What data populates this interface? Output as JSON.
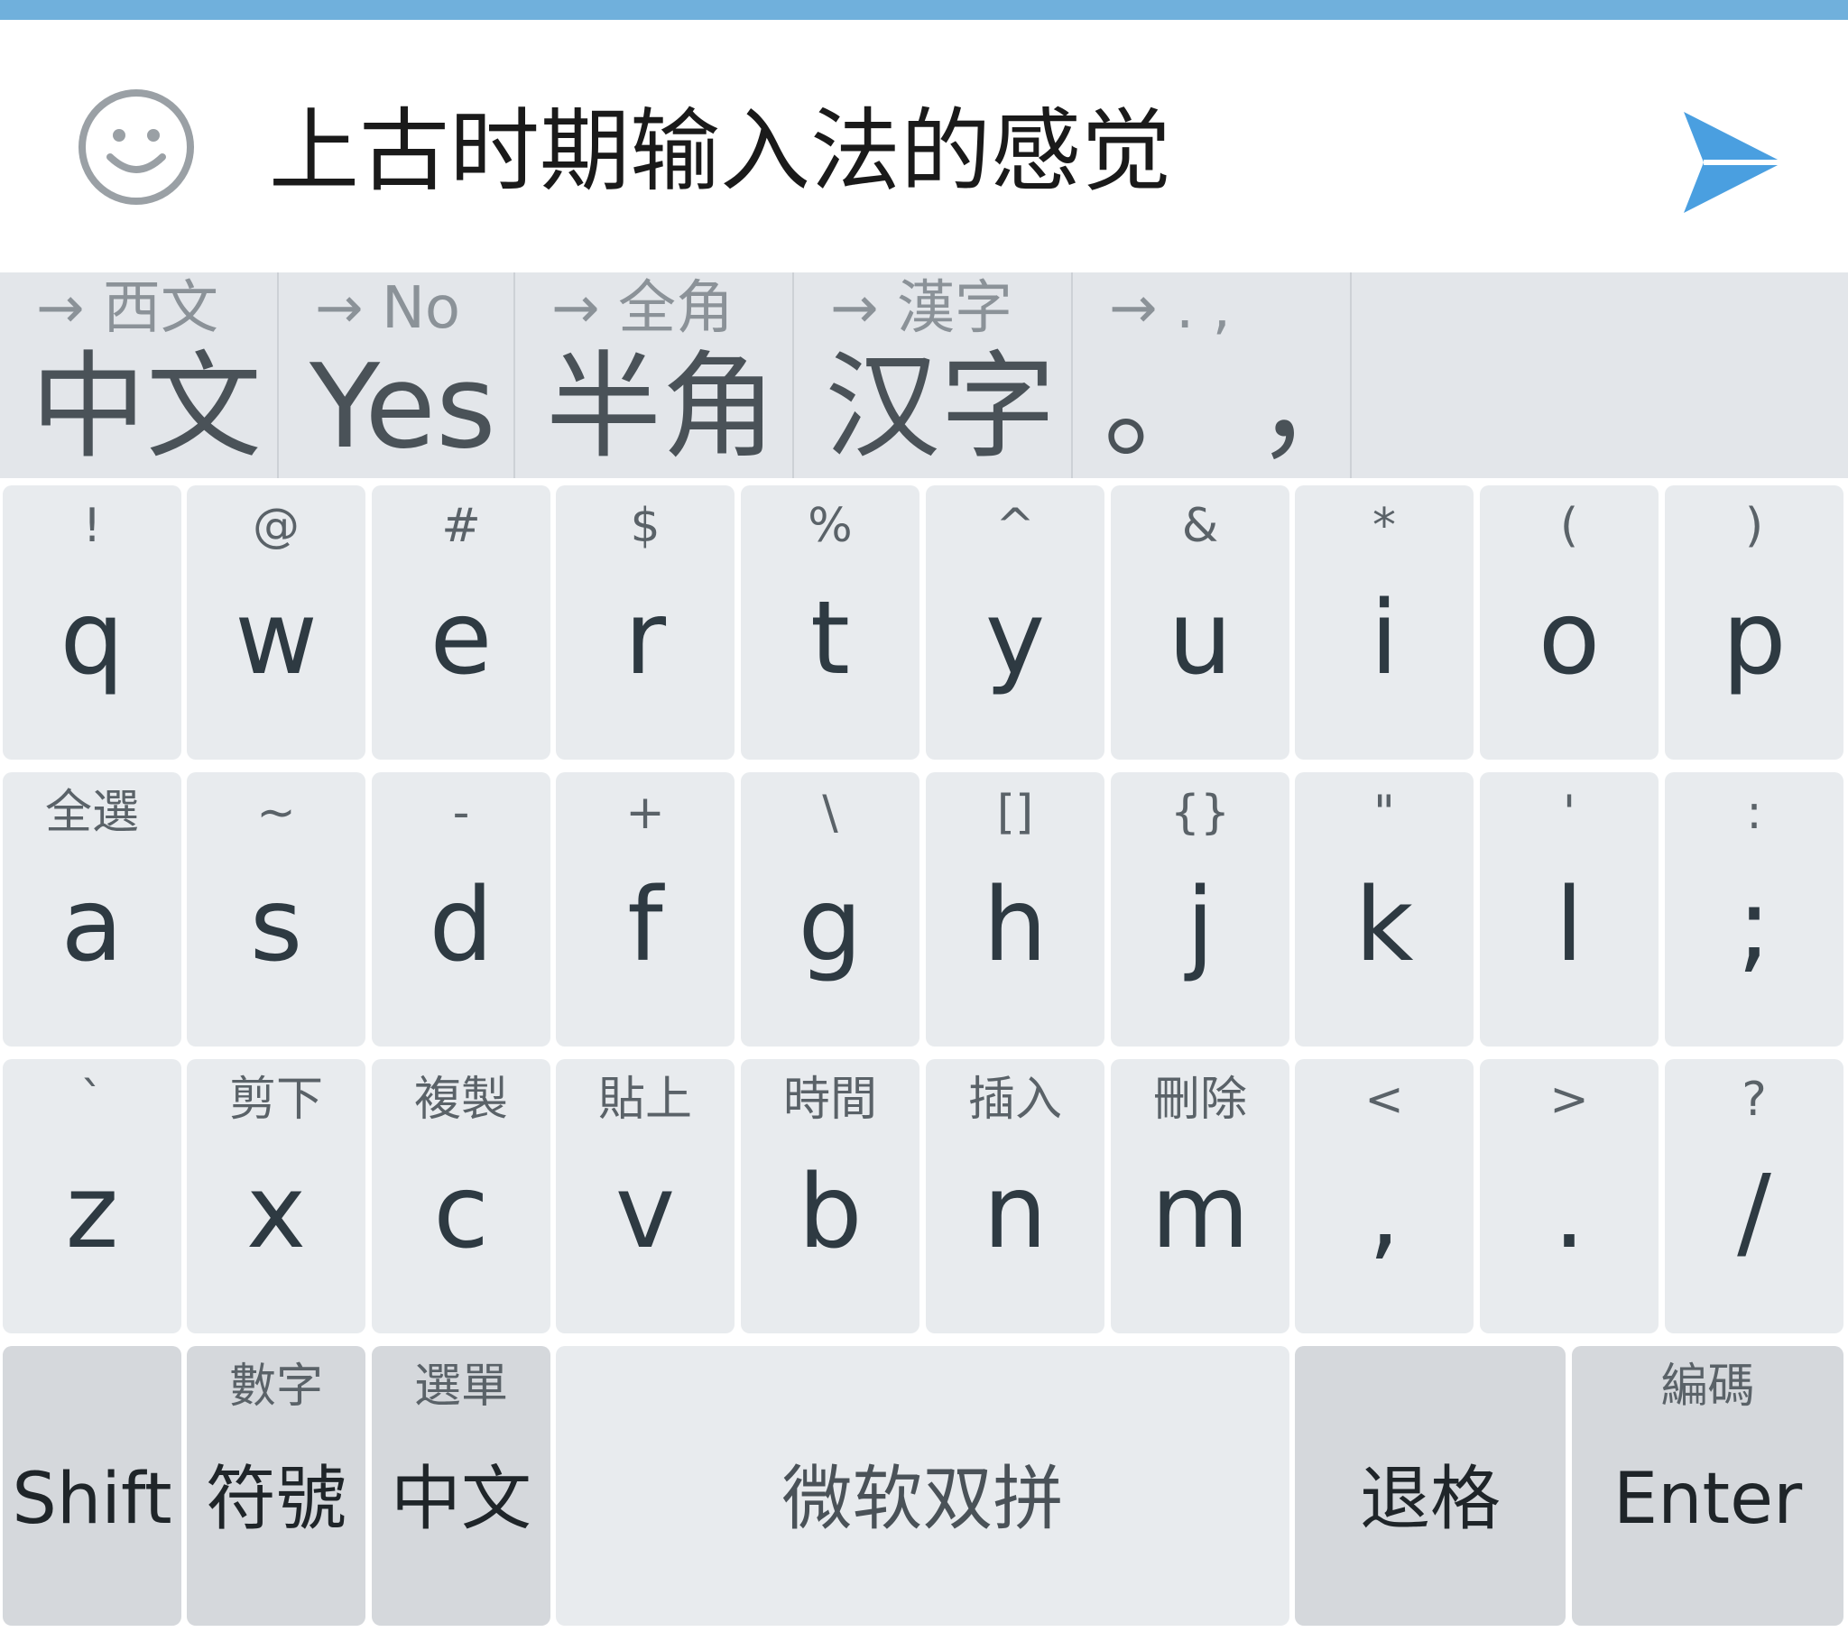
{
  "composer": {
    "message": "上古时期输入法的感觉",
    "emoji_icon": "smiley-face-icon",
    "send_icon": "send-arrow-icon",
    "accent_color": "#4a9fe0"
  },
  "mode_toggles": [
    {
      "hint": "→ 西文",
      "label": "中文"
    },
    {
      "hint": "→ No",
      "label": "Yes"
    },
    {
      "hint": "→ 全角",
      "label": "半角"
    },
    {
      "hint": "→ 漢字",
      "label": "汉字"
    },
    {
      "hint": "→ .  ,",
      "label": "。 ，"
    }
  ],
  "keyboard": {
    "row1": [
      {
        "alt": "!",
        "key": "q"
      },
      {
        "alt": "@",
        "key": "w"
      },
      {
        "alt": "#",
        "key": "e"
      },
      {
        "alt": "$",
        "key": "r"
      },
      {
        "alt": "%",
        "key": "t"
      },
      {
        "alt": "^",
        "key": "y"
      },
      {
        "alt": "&",
        "key": "u"
      },
      {
        "alt": "*",
        "key": "i"
      },
      {
        "alt": "(",
        "key": "o"
      },
      {
        "alt": ")",
        "key": "p"
      }
    ],
    "row2": [
      {
        "alt": "全選",
        "key": "a"
      },
      {
        "alt": "~",
        "key": "s"
      },
      {
        "alt": "-",
        "key": "d"
      },
      {
        "alt": "+",
        "key": "f"
      },
      {
        "alt": "\\",
        "key": "g"
      },
      {
        "alt": "[]",
        "key": "h"
      },
      {
        "alt": "{}",
        "key": "j"
      },
      {
        "alt": "\"",
        "key": "k"
      },
      {
        "alt": "'",
        "key": "l"
      },
      {
        "alt": ":",
        "key": ";"
      }
    ],
    "row3": [
      {
        "alt": "`",
        "key": "z"
      },
      {
        "alt": "剪下",
        "key": "x"
      },
      {
        "alt": "複製",
        "key": "c"
      },
      {
        "alt": "貼上",
        "key": "v"
      },
      {
        "alt": "時間",
        "key": "b"
      },
      {
        "alt": "插入",
        "key": "n"
      },
      {
        "alt": "刪除",
        "key": "m"
      },
      {
        "alt": "<",
        "key": ","
      },
      {
        "alt": ">",
        "key": "."
      },
      {
        "alt": "?",
        "key": "/"
      }
    ],
    "row4": {
      "shift": {
        "alt": "",
        "key": "Shift"
      },
      "symbols": {
        "alt": "數字",
        "key": "符號"
      },
      "lang": {
        "alt": "選單",
        "key": "中文"
      },
      "space": {
        "alt": "",
        "key": "微软双拼"
      },
      "backspace": {
        "alt": "",
        "key": "退格"
      },
      "enter": {
        "alt": "編碼",
        "key": "Enter"
      }
    }
  }
}
